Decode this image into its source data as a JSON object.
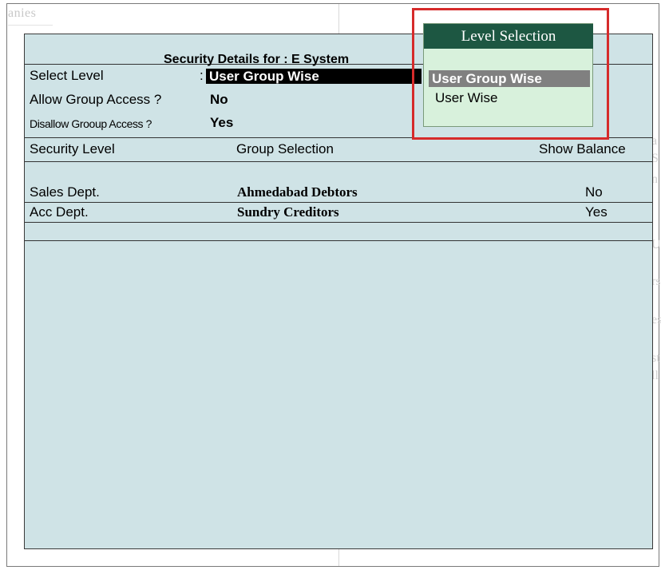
{
  "background": {
    "corner_text": "anies",
    "right_glyphs": [
      "a",
      "S",
      "n",
      "U",
      "rs",
      "es",
      "st",
      "ll"
    ]
  },
  "screen": {
    "title": "Security Details for : E System",
    "fields": {
      "select_level": {
        "label": "Select Level",
        "separator": ":",
        "value": "User Group Wise"
      },
      "allow_group_access": {
        "label": "Allow Group Access ?",
        "value": "No"
      },
      "disallow_group_access": {
        "label": "Disallow Grooup Access ?",
        "value": "Yes"
      }
    },
    "table": {
      "headers": [
        "Security Level",
        "Group Selection",
        "Show Balance"
      ],
      "rows": [
        {
          "level": "Sales Dept.",
          "group": "Ahmedabad Debtors",
          "show_balance": "No"
        },
        {
          "level": "Acc Dept.",
          "group": "Sundry Creditors",
          "show_balance": "Yes"
        }
      ]
    }
  },
  "popup": {
    "title": "Level Selection",
    "items": [
      "User Group Wise",
      "User Wise"
    ],
    "selected": "User Group Wise"
  },
  "colors": {
    "panel_bg": "#cfe3e6",
    "popup_bg": "#d8f1dc",
    "popup_title_bg": "#1d5742",
    "selected_item_bg": "#808080",
    "highlight_border": "#d62b2b"
  }
}
